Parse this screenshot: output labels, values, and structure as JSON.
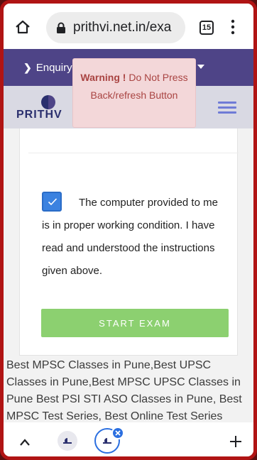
{
  "browser": {
    "url": "prithvi.net.in/exa",
    "tab_count": "15"
  },
  "enquiry": {
    "label": "Enquiry"
  },
  "logo": {
    "text": "PRITHV"
  },
  "warning": {
    "bold": "Warning !",
    "message": " Do Not Press Back/refresh Button"
  },
  "agreement": {
    "checked": true,
    "text": "The computer provided to me is in proper working condition. I have read and understood the instructions given above."
  },
  "start_button": {
    "label": "START EXAM",
    "color": "#8cd070"
  },
  "footer": {
    "text": "Best MPSC Classes in Pune,Best UPSC Classes in Pune,Best MPSC UPSC Classes in Pune Best PSI STI ASO Classes in Pune, Best MPSC Test Series, Best Online Test Series"
  },
  "colors": {
    "frame": "#b01414",
    "enquiry_strip": "#4e4487",
    "accent_blue": "#2b6fe0",
    "warning_text": "#a94442"
  },
  "icons": [
    "home-icon",
    "lock-icon",
    "tabs-icon",
    "menu-dots-icon",
    "chevron-right-icon",
    "caret-down-icon",
    "hamburger-icon",
    "check-icon",
    "chevron-up-icon",
    "close-icon",
    "plus-icon"
  ]
}
